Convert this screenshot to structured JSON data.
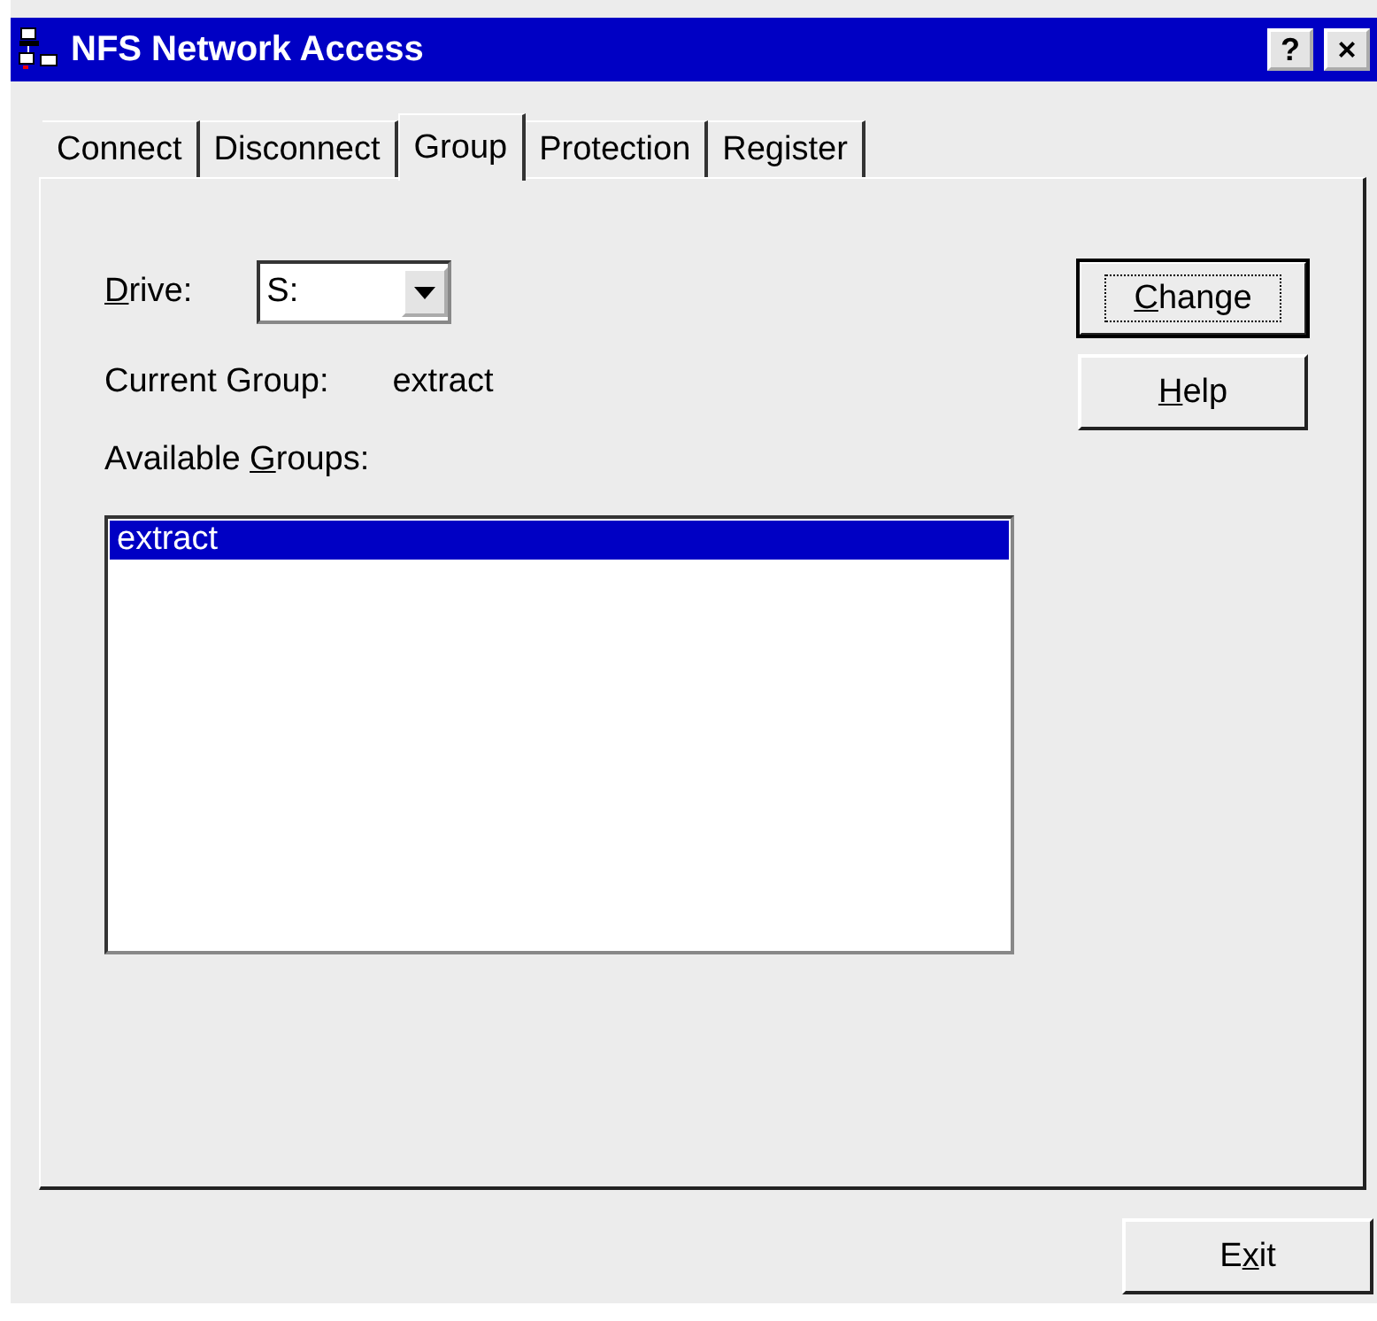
{
  "window": {
    "title": "NFS Network Access",
    "help_button": "?",
    "close_button": "×"
  },
  "tabs": [
    {
      "label": "Connect",
      "selected": false
    },
    {
      "label": "Disconnect",
      "selected": false
    },
    {
      "label": "Group",
      "selected": true
    },
    {
      "label": "Protection",
      "selected": false
    },
    {
      "label": "Register",
      "selected": false
    }
  ],
  "drive": {
    "label": {
      "key": "D",
      "post": "rive:"
    },
    "value": "S:"
  },
  "current_group": {
    "label": "Current Group:",
    "value": "extract"
  },
  "available_groups": {
    "label": {
      "pre": "Available ",
      "key": "G",
      "post": "roups:"
    },
    "items": [
      {
        "label": "extract",
        "selected": true
      }
    ]
  },
  "buttons": [
    {
      "label": {
        "key": "C",
        "post": "hange"
      },
      "default": true
    },
    {
      "label": {
        "key": "H",
        "post": "elp"
      },
      "default": false
    }
  ],
  "exit_button": {
    "label": {
      "pre": "E",
      "key": "x",
      "post": "it"
    }
  }
}
